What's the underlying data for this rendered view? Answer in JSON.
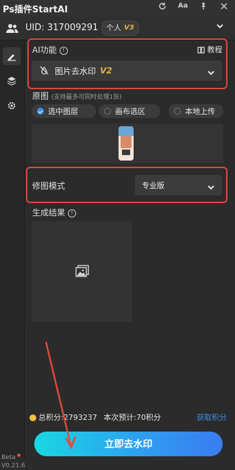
{
  "window": {
    "title": "Ps插件StartAI",
    "icons": [
      "refresh-icon",
      "font-size-icon",
      "pin-icon",
      "close-icon"
    ],
    "aa_label": "Aa"
  },
  "account": {
    "uid_label": "UID:",
    "uid_value": "317009291",
    "plan_label": "个人",
    "plan_version": "V3"
  },
  "ai_function": {
    "label": "AI功能",
    "tutorial_label": "教程",
    "selected": "图片去水印",
    "version": "V2"
  },
  "source": {
    "label": "原图",
    "note": "(支持最多可同时处理1张)",
    "options": [
      {
        "label": "选中图层",
        "selected": true
      },
      {
        "label": "画布选区",
        "selected": false
      },
      {
        "label": "本地上传",
        "selected": false
      }
    ]
  },
  "retouch": {
    "label": "修图模式",
    "selected": "专业版"
  },
  "result": {
    "label": "生成结果"
  },
  "credits": {
    "total": "总积分:2793237",
    "estimate": "本次预计:70积分",
    "get_link": "获取积分"
  },
  "action": {
    "label": "立即去水印"
  },
  "version": {
    "beta": "Beta",
    "number": "V0.21.6"
  },
  "colors": {
    "accent": "#3b8ee8",
    "highlight_border": "#e04a3a",
    "link": "#3b8ee8",
    "cta_start": "#1ad6e3",
    "cta_end": "#3a7cf0"
  }
}
